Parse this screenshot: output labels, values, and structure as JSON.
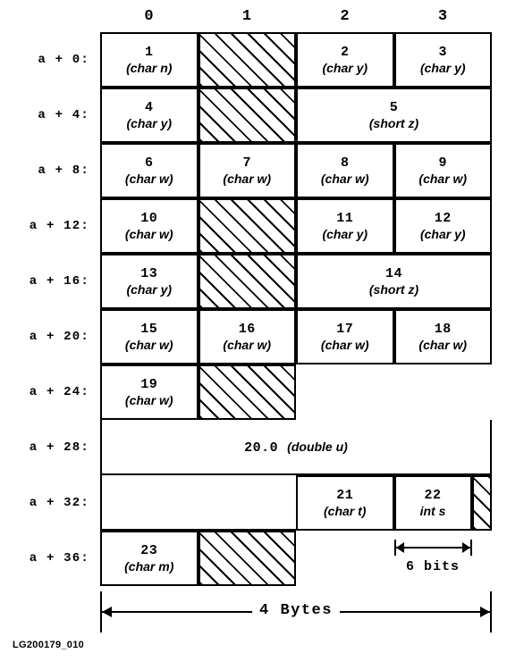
{
  "figure": {
    "caption": "LG200179_010",
    "column_headers": [
      "0",
      "1",
      "2",
      "3"
    ],
    "byte_width_label": "4 Bytes",
    "bitfield_label": "6 bits"
  },
  "rows": [
    {
      "offset_label": "a + 0:",
      "cells": [
        {
          "kind": "field",
          "number": "1",
          "type": "(char n)",
          "span": 1
        },
        {
          "kind": "padding",
          "number": "",
          "type": "",
          "span": 1
        },
        {
          "kind": "field",
          "number": "2",
          "type": "(char y)",
          "span": 1
        },
        {
          "kind": "field",
          "number": "3",
          "type": "(char y)",
          "span": 1
        }
      ]
    },
    {
      "offset_label": "a + 4:",
      "cells": [
        {
          "kind": "field",
          "number": "4",
          "type": "(char y)",
          "span": 1
        },
        {
          "kind": "padding",
          "number": "",
          "type": "",
          "span": 1
        },
        {
          "kind": "field",
          "number": "5",
          "type": "(short z)",
          "span": 2
        }
      ]
    },
    {
      "offset_label": "a + 8:",
      "cells": [
        {
          "kind": "field",
          "number": "6",
          "type": "(char w)",
          "span": 1
        },
        {
          "kind": "field",
          "number": "7",
          "type": "(char w)",
          "span": 1
        },
        {
          "kind": "field",
          "number": "8",
          "type": "(char w)",
          "span": 1
        },
        {
          "kind": "field",
          "number": "9",
          "type": "(char w)",
          "span": 1
        }
      ]
    },
    {
      "offset_label": "a + 12:",
      "cells": [
        {
          "kind": "field",
          "number": "10",
          "type": "(char w)",
          "span": 1
        },
        {
          "kind": "padding",
          "number": "",
          "type": "",
          "span": 1
        },
        {
          "kind": "field",
          "number": "11",
          "type": "(char y)",
          "span": 1
        },
        {
          "kind": "field",
          "number": "12",
          "type": "(char y)",
          "span": 1
        }
      ]
    },
    {
      "offset_label": "a + 16:",
      "cells": [
        {
          "kind": "field",
          "number": "13",
          "type": "(char y)",
          "span": 1
        },
        {
          "kind": "padding",
          "number": "",
          "type": "",
          "span": 1
        },
        {
          "kind": "field",
          "number": "14",
          "type": "(short z)",
          "span": 2
        }
      ]
    },
    {
      "offset_label": "a + 20:",
      "cells": [
        {
          "kind": "field",
          "number": "15",
          "type": "(char w)",
          "span": 1
        },
        {
          "kind": "field",
          "number": "16",
          "type": "(char w)",
          "span": 1
        },
        {
          "kind": "field",
          "number": "17",
          "type": "(char w)",
          "span": 1
        },
        {
          "kind": "field",
          "number": "18",
          "type": "(char w)",
          "span": 1
        }
      ]
    },
    {
      "offset_label": "a + 24:",
      "cells": [
        {
          "kind": "field",
          "number": "19",
          "type": "(char w)",
          "span": 1
        },
        {
          "kind": "padding",
          "number": "",
          "type": "",
          "span": 1
        },
        {
          "kind": "open",
          "number": "",
          "type": "",
          "span": 2
        }
      ]
    },
    {
      "offset_label": "a + 28:",
      "cells": [
        {
          "kind": "wide",
          "number": "20.0",
          "type": "(double u)",
          "span": 4
        }
      ]
    },
    {
      "offset_label": "a + 32:",
      "cells": [
        {
          "kind": "open",
          "number": "",
          "type": "",
          "span": 2
        },
        {
          "kind": "field",
          "number": "21",
          "type": "(char t)",
          "span": 1
        },
        {
          "kind": "bitfield",
          "number": "22",
          "type": "int s",
          "span": 1
        }
      ]
    },
    {
      "offset_label": "a + 36:",
      "cells": [
        {
          "kind": "field",
          "number": "23",
          "type": "(char m)",
          "span": 1
        },
        {
          "kind": "padding",
          "number": "",
          "type": "",
          "span": 1
        },
        {
          "kind": "open",
          "number": "",
          "type": "",
          "span": 2
        }
      ]
    }
  ]
}
